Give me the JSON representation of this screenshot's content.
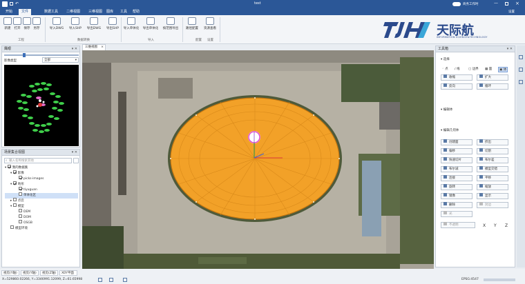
{
  "window": {
    "title": "test",
    "toggle_label": "商务工作时",
    "settings_label": "设置"
  },
  "menu": [
    "开始",
    "文件",
    "数据工具",
    "二维视图",
    "三维视图",
    "图库",
    "工具",
    "帮助"
  ],
  "ribbon": {
    "buttons": [
      "新建",
      "打开",
      "保存",
      "另存",
      "导入DWG",
      "导入SHP",
      "导出DWG",
      "导出SHP",
      "导入单体化",
      "导出单体化",
      "按范围导出",
      "路径配置",
      "资源查看"
    ],
    "groups": [
      "工程",
      "数据转换",
      "导入",
      "配置",
      "设置"
    ]
  },
  "brand": {
    "logo": "TJH",
    "name": "天际航",
    "tagline": "INFORMATION SCIENCE&TECHNOLOGY"
  },
  "nav_panel": {
    "title": "鹰眼",
    "type_label": "影像类型",
    "type_value": "全部"
  },
  "scene_panel": {
    "title": "场景集合视图",
    "search_placeholder": "输入名称搜索其他",
    "tree": [
      {
        "label": "我的数据集",
        "checked": true,
        "indent": 0
      },
      {
        "label": "影像",
        "checked": true,
        "indent": 1
      },
      {
        "label": "picks-images",
        "checked": true,
        "indent": 2
      },
      {
        "label": "地形",
        "checked": true,
        "indent": 1
      },
      {
        "label": "tiyuguan",
        "checked": true,
        "indent": 2
      },
      {
        "label": "单体化区",
        "checked": false,
        "indent": 2
      },
      {
        "label": "点云",
        "checked": false,
        "indent": 1
      },
      {
        "label": "模型",
        "checked": false,
        "indent": 1
      },
      {
        "label": "DEM",
        "checked": false,
        "indent": 2
      },
      {
        "label": "DOM",
        "checked": false,
        "indent": 2
      },
      {
        "label": "OSGB",
        "checked": false,
        "indent": 2
      },
      {
        "label": "模型环境",
        "checked": false,
        "indent": 1
      }
    ]
  },
  "view_tab": {
    "label": "三维视图"
  },
  "tool_panel": {
    "title": "工具箱",
    "select_section": "选择",
    "select_modes": [
      "点",
      "线",
      "边界",
      "面",
      "体"
    ],
    "select_buttons": [
      "收缩",
      "扩大",
      "反向",
      "循环"
    ],
    "edit_body_section": "编辑体",
    "edit_geom_section": "编辑几何体",
    "geom_buttons": [
      "创建面",
      "挤出",
      "偏移",
      "切割",
      "快速切片",
      "布尔差",
      "布尔减",
      "模型交错",
      "连接",
      "平移",
      "旋转",
      "缩放",
      "镜像",
      "显示",
      "删除",
      "封边"
    ],
    "extra_buttons": [
      "光",
      "不透明"
    ],
    "axes": [
      "X",
      "Y",
      "Z"
    ]
  },
  "status": {
    "tabs": [
      "视见(Y轴)",
      "视见(Y轴)",
      "视见(Z轴)",
      "XOY平面"
    ],
    "coords": "X=529860.02266, Y=3346991.12099, Z=61.65998",
    "epsg": "EPSG:4547"
  }
}
